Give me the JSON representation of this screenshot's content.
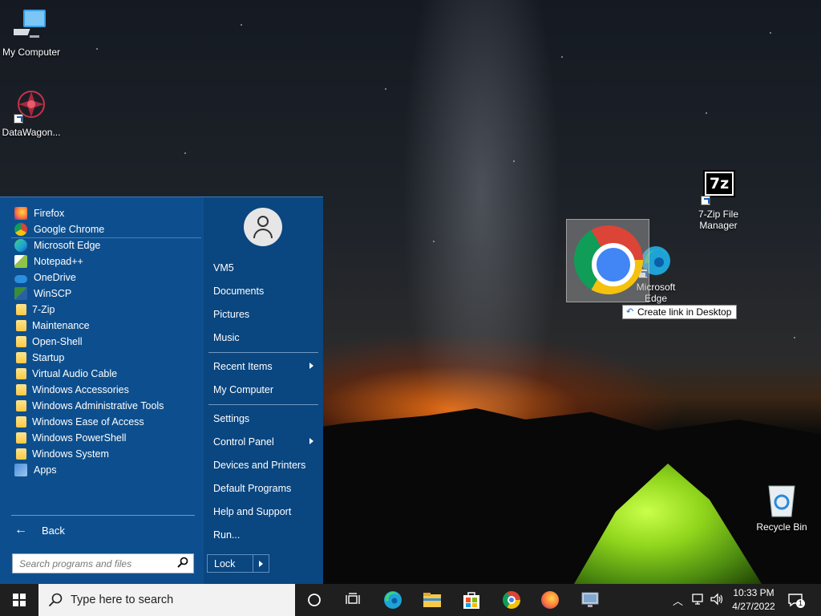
{
  "desktop": {
    "icons": [
      {
        "label": "My Computer",
        "icon": "computer-icon"
      },
      {
        "label": "DataWagon...",
        "icon": "datawagon-icon"
      },
      {
        "label": "7-Zip File Manager",
        "icon": "7zip-icon"
      },
      {
        "label": "Microsoft Edge",
        "icon": "edge-icon"
      },
      {
        "label": "Recycle Bin",
        "icon": "recycle-bin-icon"
      }
    ],
    "drag_tooltip": "Create link in Desktop",
    "dragged_item_icon": "chrome-icon",
    "sevenzip_badge": "7z"
  },
  "start_menu": {
    "programs": [
      {
        "label": "Firefox",
        "icon": "firefox-icon",
        "color": "#ff7139"
      },
      {
        "label": "Google Chrome",
        "icon": "chrome-icon",
        "color": "#4285f4"
      },
      {
        "label": "Microsoft Edge",
        "icon": "edge-icon",
        "color": "#1fa2d6"
      },
      {
        "label": "Notepad++",
        "icon": "notepadpp-icon",
        "color": "#90c24a"
      },
      {
        "label": "OneDrive",
        "icon": "onedrive-icon",
        "color": "#2b8fe0"
      },
      {
        "label": "WinSCP",
        "icon": "winscp-icon",
        "color": "#3b8c3b"
      },
      {
        "label": "7-Zip",
        "icon": "folder-icon"
      },
      {
        "label": "Maintenance",
        "icon": "folder-icon"
      },
      {
        "label": "Open-Shell",
        "icon": "folder-icon"
      },
      {
        "label": "Startup",
        "icon": "folder-icon"
      },
      {
        "label": "Virtual Audio Cable",
        "icon": "folder-icon"
      },
      {
        "label": "Windows Accessories",
        "icon": "folder-icon"
      },
      {
        "label": "Windows Administrative Tools",
        "icon": "folder-icon"
      },
      {
        "label": "Windows Ease of Access",
        "icon": "folder-icon"
      },
      {
        "label": "Windows PowerShell",
        "icon": "folder-icon"
      },
      {
        "label": "Windows System",
        "icon": "folder-icon"
      },
      {
        "label": "Apps",
        "icon": "apps-icon",
        "color": "#4a90d9"
      }
    ],
    "back_label": "Back",
    "search_placeholder": "Search programs and files",
    "right_items": [
      {
        "label": "VM5"
      },
      {
        "label": "Documents"
      },
      {
        "label": "Pictures"
      },
      {
        "label": "Music"
      },
      {
        "label": "Recent Items",
        "submenu": true
      },
      {
        "label": "My Computer"
      },
      {
        "label": "Settings"
      },
      {
        "label": "Control Panel",
        "submenu": true
      },
      {
        "label": "Devices and Printers"
      },
      {
        "label": "Default Programs"
      },
      {
        "label": "Help and Support"
      },
      {
        "label": "Run..."
      }
    ],
    "lock_label": "Lock"
  },
  "taskbar": {
    "search_placeholder": "Type here to search",
    "pinned": [
      "cortana-icon",
      "task-view-icon",
      "edge-icon",
      "file-explorer-icon",
      "store-icon",
      "chrome-icon",
      "firefox-icon",
      "remote-desktop-icon"
    ],
    "time": "10:33 PM",
    "date": "4/27/2022",
    "notification_count": "1",
    "tray_icons": [
      "chevron-up-icon",
      "network-icon",
      "volume-icon"
    ]
  },
  "colors": {
    "start_menu_bg": "#0d4f8e",
    "taskbar_bg": "#1f1f1f",
    "folder": "#f7c948"
  }
}
